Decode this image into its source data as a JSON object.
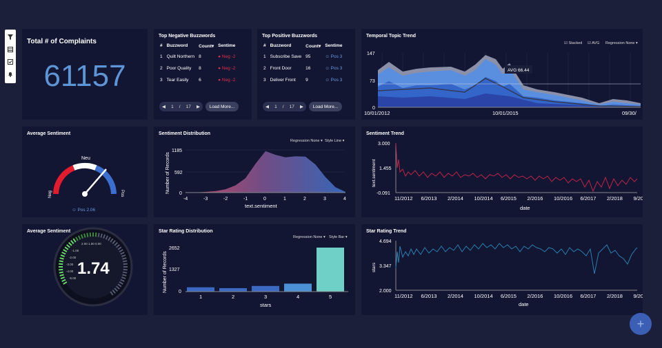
{
  "toolbar": {
    "icons": [
      "filter-icon",
      "table-icon",
      "checklist-icon",
      "bell-icon"
    ]
  },
  "complaints": {
    "title": "Total # of Complaints",
    "value": "61157"
  },
  "negative": {
    "title": "Top Negative Buzzwords",
    "headers": [
      "#",
      "Buzzword",
      "Count",
      "Sentime"
    ],
    "rows": [
      {
        "n": "1",
        "word": "Quilt Northern",
        "count": "8",
        "sent": "Neg -2"
      },
      {
        "n": "2",
        "word": "Poor Quality",
        "count": "8",
        "sent": "Neg -2"
      },
      {
        "n": "3",
        "word": "Tear Easily",
        "count": "6",
        "sent": "Neg -2"
      }
    ],
    "pager": {
      "page": "1",
      "sep": "/",
      "total": "17"
    },
    "load_more": "Load More..."
  },
  "positive": {
    "title": "Top Positive Buzzwords",
    "headers": [
      "#",
      "Buzzword",
      "Count",
      "Sentime"
    ],
    "rows": [
      {
        "n": "1",
        "word": "Subscribe Save",
        "count": "95",
        "sent": "Pos 3"
      },
      {
        "n": "2",
        "word": "Front Door",
        "count": "16",
        "sent": "Pos 3"
      },
      {
        "n": "3",
        "word": "Deliver Front",
        "count": "9",
        "sent": "Pos 3"
      }
    ],
    "pager": {
      "page": "1",
      "sep": "/",
      "total": "17"
    },
    "load_more": "Load More..."
  },
  "temporal": {
    "title": "Temporal Topic Trend",
    "controls": {
      "stacked": "Stacked",
      "avg": "AVG",
      "regression": "Regression None"
    },
    "avg_label": "AVG 66.44",
    "yticks": [
      "147",
      "73",
      "0"
    ],
    "xticks": [
      "10/01/2012",
      "10/01/2015",
      "09/30/"
    ]
  },
  "avg_sentiment": {
    "title": "Average Sentiment",
    "neu": "Neu",
    "neg": "Neg",
    "pos": "Pos",
    "value": "Pos 2.06"
  },
  "sent_dist": {
    "title": "Sentiment Distribution",
    "controls": {
      "regression": "Regression None",
      "style": "Style Line"
    },
    "ylabel": "Number of Records",
    "xlabel": "text.sentiment",
    "yticks": [
      "1185",
      "592",
      "0"
    ],
    "xticks": [
      "-4",
      "-3",
      "-2",
      "-1",
      "0",
      "1",
      "2",
      "3",
      "4"
    ]
  },
  "sent_trend": {
    "title": "Sentiment Trend",
    "ylabel": "text.sentiment",
    "xlabel": "date",
    "yticks": [
      "3.000",
      "1.455",
      "-0.091"
    ],
    "xticks": [
      "11/2012",
      "6/2013",
      "2/2014",
      "10/2014",
      "6/2015",
      "2/2016",
      "10/2016",
      "6/2017",
      "2/2018",
      "9/20"
    ]
  },
  "avg_sentiment2": {
    "title": "Average Sentiment",
    "value": "1.74",
    "ticks": [
      "2.00",
      "1.00",
      "0.00",
      "-1.00",
      "-2.00",
      "-3.00",
      "-4.00",
      "-5.00"
    ]
  },
  "star_dist": {
    "title": "Star Rating Distribution",
    "controls": {
      "regression": "Regression None",
      "style": "Style Bar"
    },
    "ylabel": "Number of Records",
    "xlabel": "stars",
    "yticks": [
      "2652",
      "1327",
      "0"
    ]
  },
  "star_trend": {
    "title": "Star Rating Trend",
    "ylabel": "stars",
    "xlabel": "date",
    "yticks": [
      "4.694",
      "3.347",
      "2.000"
    ],
    "xticks": [
      "11/2012",
      "6/2013",
      "2/2014",
      "10/2014",
      "6/2015",
      "2/2016",
      "10/2016",
      "6/2017",
      "2/2018",
      "9/20"
    ]
  },
  "chart_data": [
    {
      "type": "bar",
      "title": "Star Rating Distribution",
      "categories": [
        "1",
        "2",
        "3",
        "4",
        "5"
      ],
      "values": [
        260,
        210,
        340,
        480,
        2652
      ],
      "xlabel": "stars",
      "ylabel": "Number of Records",
      "ylim": [
        0,
        2652
      ]
    },
    {
      "type": "area",
      "title": "Sentiment Distribution",
      "x": [
        -4,
        -3.5,
        -3,
        -2.5,
        -2,
        -1.5,
        -1,
        -0.5,
        0,
        0.5,
        1,
        1.5,
        2,
        2.5,
        3,
        3.5,
        4
      ],
      "values": [
        0,
        5,
        20,
        40,
        90,
        200,
        400,
        800,
        1150,
        1050,
        980,
        1010,
        1000,
        780,
        430,
        150,
        20
      ],
      "xlabel": "text.sentiment",
      "ylabel": "Number of Records",
      "ylim": [
        0,
        1185
      ]
    }
  ]
}
